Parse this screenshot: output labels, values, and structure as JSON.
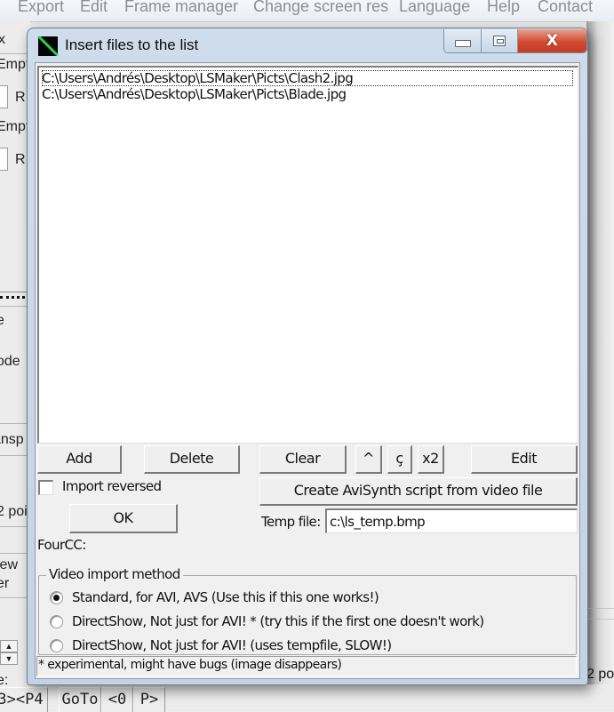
{
  "background_app": {
    "menu": [
      "Export",
      "Edit",
      "Frame manager",
      "Change screen res",
      "Language",
      "Help",
      "Contact"
    ],
    "left_fragments": [
      "x",
      "Empt",
      "R",
      "Empt",
      "R",
      "e",
      "ode",
      "ansp",
      "2 poi",
      "iew",
      "er",
      "e:"
    ],
    "right_fragment": "2 poi",
    "bottom_buttons": [
      "3><P4",
      "GoTo",
      "<0",
      "P>"
    ],
    "spin_up": "▲",
    "spin_down": "▼"
  },
  "dialog": {
    "title": "Insert files to the list",
    "caption_buttons": {
      "minimize": "minimize",
      "maximize": "maximize",
      "close": "X"
    },
    "file_list": [
      "C:\\Users\\Andrés\\Desktop\\LSMaker\\Picts\\Clash2.jpg",
      "C:\\Users\\Andrés\\Desktop\\LSMaker\\Picts\\Blade.jpg"
    ],
    "buttons": {
      "add": "Add",
      "delete": "Delete",
      "clear": "Clear",
      "up": "^",
      "cedilla": "ç",
      "x2": "x2",
      "edit": "Edit",
      "avisynth": "Create AviSynth script from video file",
      "ok": "OK"
    },
    "import_reversed": {
      "label": "Import reversed",
      "checked": false
    },
    "temp_file": {
      "label": "Temp file:",
      "value": "c:\\ls_temp.bmp"
    },
    "fourcc_label": "FourCC:",
    "video_import": {
      "legend": "Video import method",
      "options": [
        {
          "label": "Standard, for AVI, AVS (Use this if this one works!)",
          "checked": true
        },
        {
          "label": "DirectShow, Not just for AVI! * (try this if the first one doesn't work)",
          "checked": false
        },
        {
          "label": "DirectShow, Not just for AVI! (uses tempfile, SLOW!)",
          "checked": false
        }
      ]
    },
    "footnote": "* experimental, might have bugs (image disappears)"
  }
}
